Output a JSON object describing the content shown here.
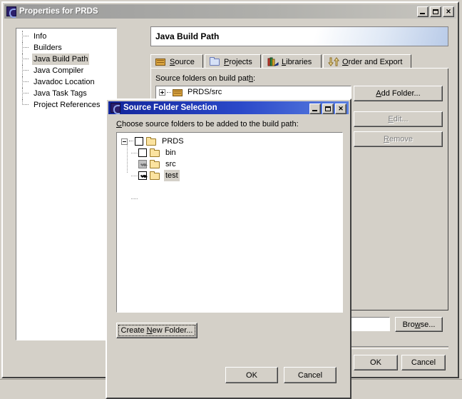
{
  "main_window": {
    "title": "Properties for PRDS",
    "icon": "eclipse-icon",
    "titlebar_buttons": [
      {
        "name": "minimize-button",
        "label": "_"
      },
      {
        "name": "maximize-button",
        "label": "□"
      },
      {
        "name": "close-button",
        "label": "✕"
      }
    ],
    "sidebar": {
      "items": [
        {
          "label": "Info",
          "selected": false
        },
        {
          "label": "Builders",
          "selected": false
        },
        {
          "label": "Java Build Path",
          "selected": true
        },
        {
          "label": "Java Compiler",
          "selected": false
        },
        {
          "label": "Javadoc Location",
          "selected": false
        },
        {
          "label": "Java Task Tags",
          "selected": false
        },
        {
          "label": "Project References",
          "selected": false
        }
      ]
    },
    "page_title": "Java Build Path",
    "tabs": [
      {
        "label": "Source",
        "mnemonic": "S",
        "icon": "package-folder-icon",
        "active": true
      },
      {
        "label": "Projects",
        "mnemonic": "P",
        "icon": "open-folder-icon",
        "active": false
      },
      {
        "label": "Libraries",
        "mnemonic": "L",
        "icon": "books-icon",
        "active": false
      },
      {
        "label": "Order and Export",
        "mnemonic": "O",
        "icon": "order-arrows-icon",
        "active": false
      }
    ],
    "source_label": "Source folders on build path:",
    "source_entries": [
      {
        "label": "PRDS/src",
        "icon": "package-folder-icon",
        "expander": "plus"
      }
    ],
    "buttons": {
      "add_folder": {
        "label": "Add Folder...",
        "mnemonic": "A",
        "disabled": false
      },
      "edit": {
        "label": "Edit...",
        "mnemonic": "E",
        "disabled": true
      },
      "remove": {
        "label": "Remove",
        "mnemonic": "R",
        "disabled": true
      },
      "browse": {
        "label": "Browse...",
        "mnemonic": "w",
        "disabled": false
      },
      "ok": {
        "label": "OK",
        "disabled": false
      },
      "cancel": {
        "label": "Cancel",
        "disabled": false
      }
    },
    "output_field_value": ""
  },
  "dialog": {
    "title": "Source Folder Selection",
    "icon": "eclipse-icon",
    "titlebar_buttons": [
      {
        "name": "minimize-button",
        "label": "_"
      },
      {
        "name": "maximize-button",
        "label": "□"
      },
      {
        "name": "close-button",
        "label": "✕"
      }
    ],
    "prompt": "Choose source folders to be added to the build path:",
    "prompt_mnemonic": "C",
    "tree": [
      {
        "label": "PRDS",
        "level": 0,
        "checkbox": "unchecked",
        "expander": "minus",
        "icon": "open-folder-icon",
        "selected": false
      },
      {
        "label": "bin",
        "level": 1,
        "checkbox": "unchecked",
        "expander": "none",
        "icon": "folder-icon",
        "selected": false
      },
      {
        "label": "src",
        "level": 1,
        "checkbox": "checked-disabled",
        "expander": "none",
        "icon": "folder-icon",
        "selected": false
      },
      {
        "label": "test",
        "level": 1,
        "checkbox": "checked",
        "expander": "none",
        "icon": "folder-icon",
        "selected": true
      }
    ],
    "buttons": {
      "create_new_folder": {
        "label": "Create New Folder...",
        "mnemonic": "N",
        "focused": true
      },
      "ok": {
        "label": "OK"
      },
      "cancel": {
        "label": "Cancel"
      }
    }
  },
  "colors": {
    "face": "#d4d0c8",
    "active_title": "#12259b",
    "inactive_title": "#9a9a9a",
    "selection": "#d4d0c8",
    "folder": "#fbe3a0",
    "package_folder": "#d9a441"
  }
}
